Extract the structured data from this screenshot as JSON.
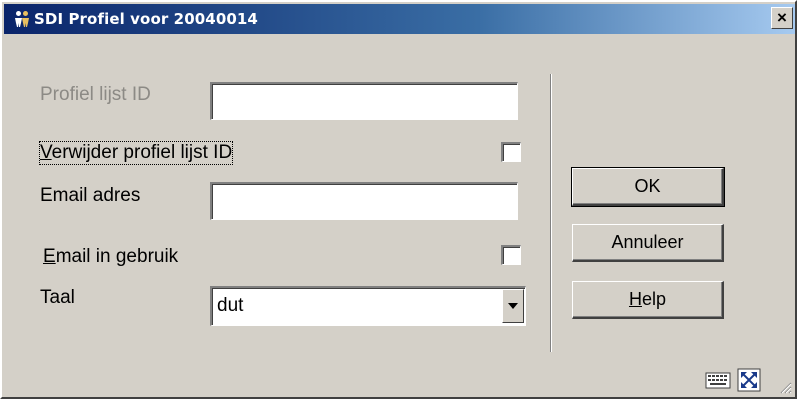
{
  "window": {
    "title": "SDI Profiel voor 20040014",
    "close_symbol": "×",
    "icon": "people-icon"
  },
  "form": {
    "profile_list_id": {
      "label": "Profiel lijst ID",
      "value": "",
      "disabled": true
    },
    "delete_profile_list_id": {
      "label": "Verwijder profiel lijst ID",
      "checked": false
    },
    "email_address": {
      "label": "Email adres",
      "value": ""
    },
    "email_in_use": {
      "label": "Email in gebruik",
      "mnemonic": "E",
      "label_rest": "mail in gebruik",
      "checked": false
    },
    "language": {
      "label": "Taal",
      "value": "dut"
    }
  },
  "buttons": {
    "ok": "OK",
    "cancel": "Annuleer",
    "help": "Help",
    "help_mnemonic": "H",
    "help_rest": "elp"
  },
  "status_icons": [
    "keyboard-icon",
    "maximize-icon",
    "resize-grip-icon"
  ],
  "colors": {
    "face": "#d4d0c8",
    "title_start": "#0a246a",
    "title_end": "#a6caf0"
  }
}
